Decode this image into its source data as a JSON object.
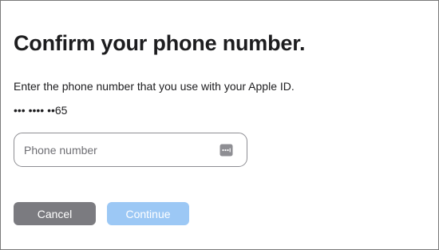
{
  "dialog": {
    "title": "Confirm your phone number.",
    "description": "Enter the phone number that you use with your Apple ID.",
    "masked_number": "••• •••• ••65"
  },
  "phone_field": {
    "placeholder": "Phone number",
    "value": "",
    "icon": "autofill-keyboard-icon"
  },
  "buttons": {
    "cancel_label": "Cancel",
    "continue_label": "Continue",
    "continue_enabled": false
  },
  "colors": {
    "cancel_bg": "#7b7b80",
    "continue_bg_disabled": "#9cc8f5",
    "field_border": "#8e8e93",
    "text": "#1d1d1f"
  }
}
